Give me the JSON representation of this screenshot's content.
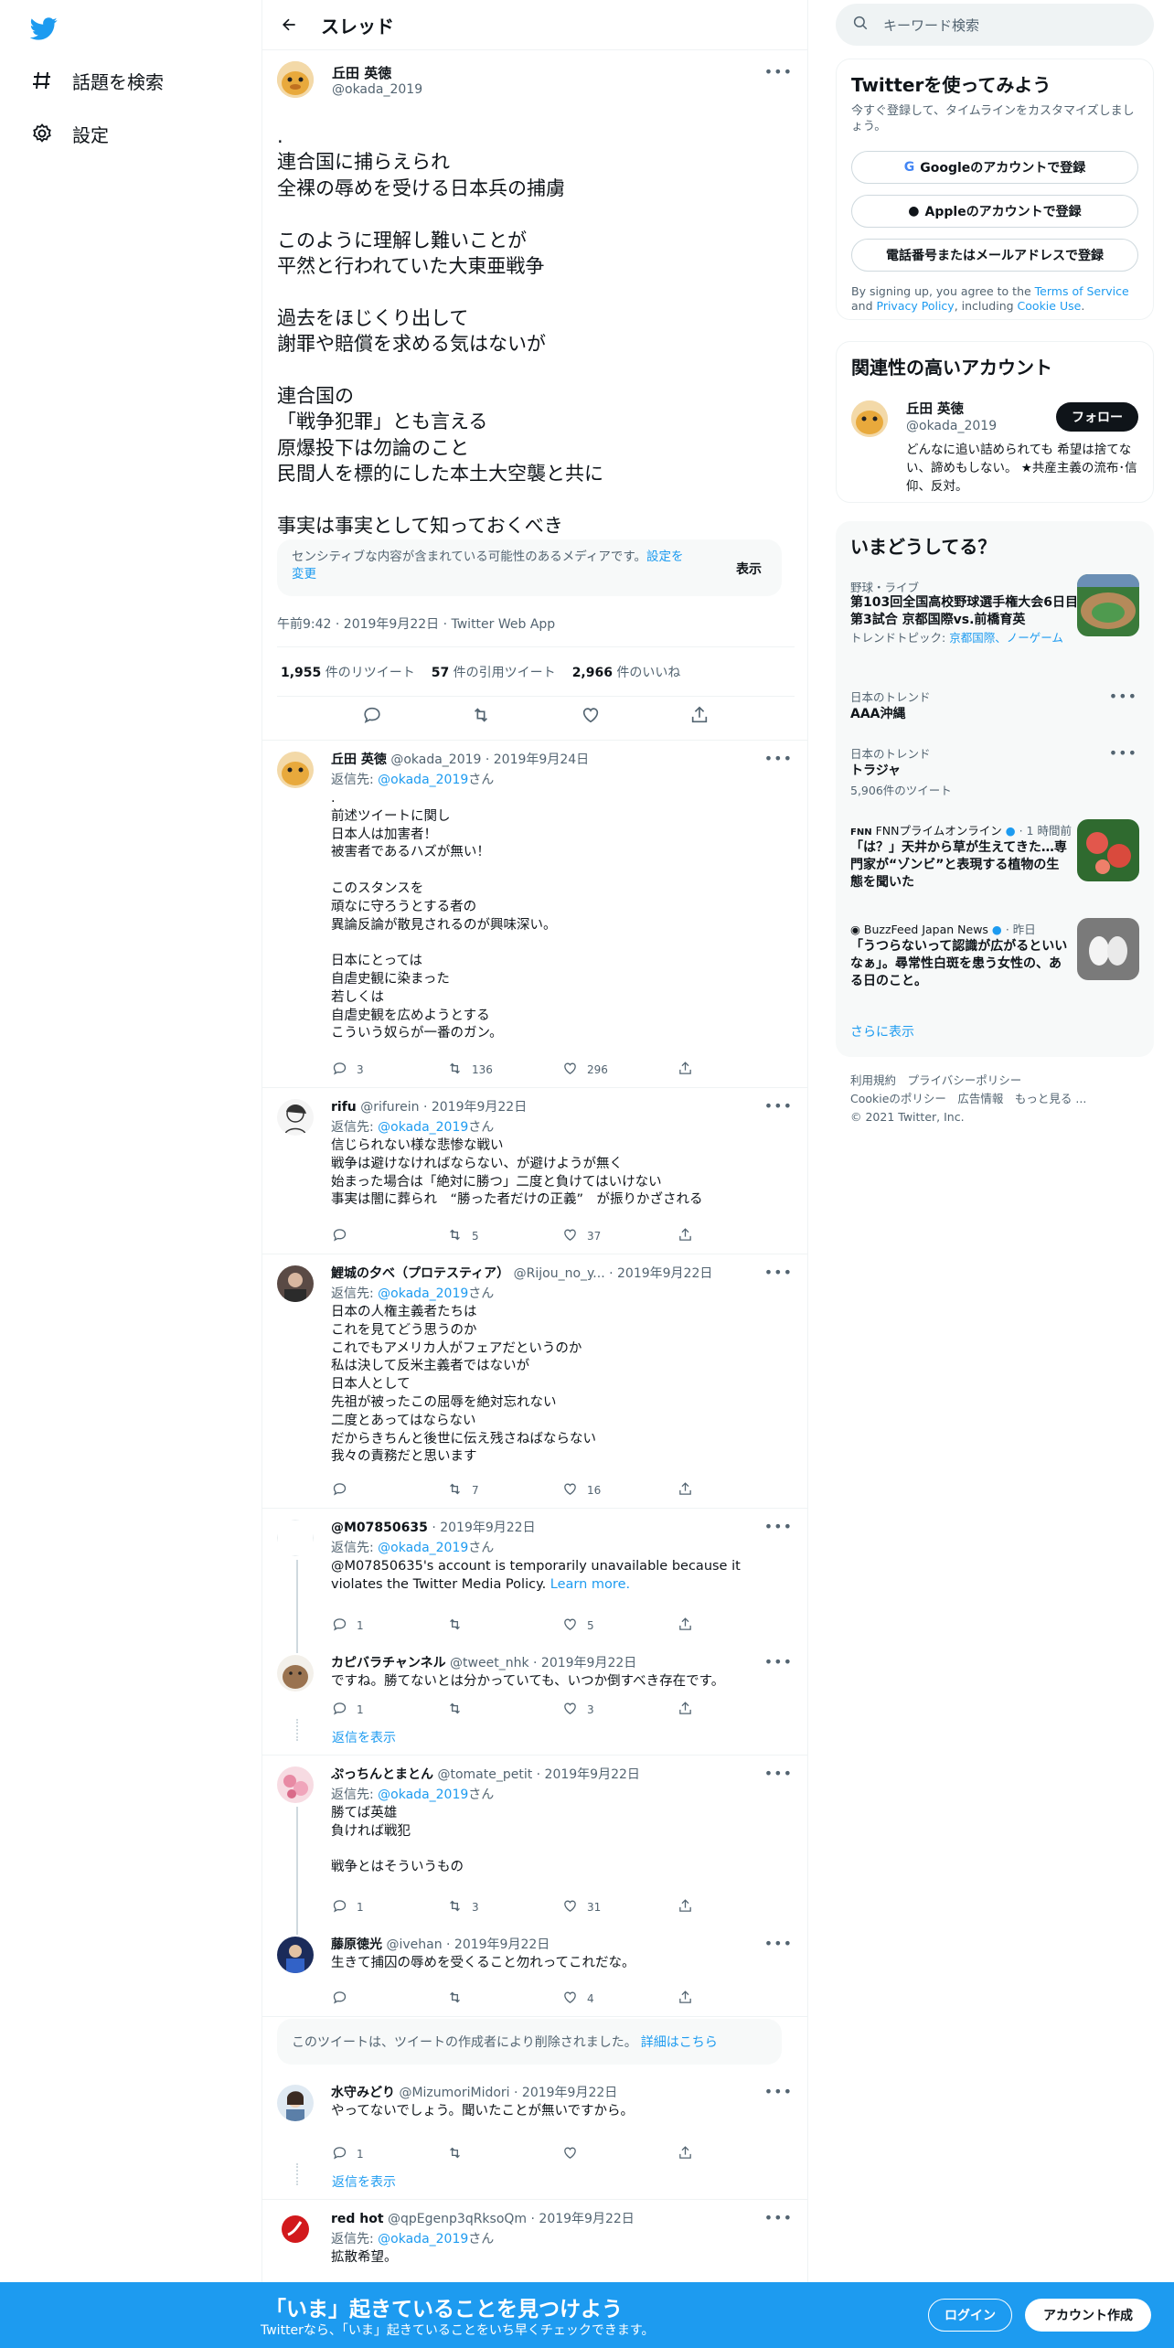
{
  "nav": {
    "explore": "話題を検索",
    "settings": "設定"
  },
  "header": {
    "title": "スレッド"
  },
  "main_tweet": {
    "name": "丘田 英徳",
    "handle": "@okada_2019",
    "text": ".\n連合国に捕らえられ\n全裸の辱めを受ける日本兵の捕虜\n\nこのように理解し難いことが\n平然と行われていた大東亜戦争\n\n過去をほじくり出して\n謝罪や賠償を求める気はないが\n\n連合国の\n「戦争犯罪」とも言える\n原爆投下は勿論のこと\n民間人を標的にした本土大空襲と共に\n\n事実は事実として知っておくべき",
    "sensitive_text": "センシティブな内容が含まれている可能性のあるメディアです。",
    "sensitive_link": "設定を変更",
    "sensitive_show": "表示",
    "meta": "午前9:42 · 2019年9月22日 · Twitter Web App",
    "retweets_num": "1,955",
    "retweets_label": " 件のリツイート",
    "quotes_num": "57",
    "quotes_label": " 件の引用ツイート",
    "likes_num": "2,966",
    "likes_label": " 件のいいね"
  },
  "replies": [
    {
      "name": "丘田 英徳",
      "handle": "@okada_2019 · 2019年9月24日",
      "reply_prefix": "返信先: ",
      "reply_to": "@okada_2019",
      "reply_suffix": "さん",
      "text": ".\n前述ツイートに関し\n日本人は加害者！\n被害者であるハズが無い！\n\nこのスタンスを\n頑なに守ろうとする者の\n異論反論が散見されるのが興味深い。\n\n日本にとっては\n自虐史観に染まった\n若しくは\n自虐史観を広めようとする\nこういう奴らが一番のガン。",
      "replies": "3",
      "retweets": "136",
      "likes": "296"
    },
    {
      "name": "rifu",
      "handle": "@rifurein · 2019年9月22日",
      "reply_prefix": "返信先: ",
      "reply_to": "@okada_2019",
      "reply_suffix": "さん",
      "text": "信じられない様な悲惨な戦い\n戦争は避けなければならない、が避けようが無く\n始まった場合は「絶対に勝つ」二度と負けてはいけない\n事実は闇に葬られ　“勝った者だけの正義”　が振りかざされる",
      "replies": "",
      "retweets": "5",
      "likes": "37"
    },
    {
      "name": "鯉城の夕べ（プロテスティア）",
      "handle": "@Rijou_no_y... · 2019年9月22日",
      "reply_prefix": "返信先: ",
      "reply_to": "@okada_2019",
      "reply_suffix": "さん",
      "text": "日本の人権主義者たちは\nこれを見てどう思うのか\nこれでもアメリカ人がフェアだというのか\n私は決して反米主義者ではないが\n日本人として\n先祖が被ったこの屈辱を絶対忘れない\n二度とあってはならない\nだからきちんと後世に伝え残さねばならない\n我々の責務だと思います",
      "replies": "",
      "retweets": "7",
      "likes": "16"
    },
    {
      "name": "@M07850635",
      "handle": "· 2019年9月22日",
      "reply_prefix": "返信先: ",
      "reply_to": "@okada_2019",
      "reply_suffix": "さん",
      "text": "@M07850635's account is temporarily unavailable because it violates the Twitter Media Policy. ",
      "link": "Learn more.",
      "replies": "1",
      "retweets": "",
      "likes": "5"
    },
    {
      "name": "カピバラチャンネル",
      "handle": "@tweet_nhk · 2019年9月22日",
      "text": "ですね。勝てないとは分かっていても、いつか倒すべき存在です。",
      "replies": "1",
      "retweets": "",
      "likes": "3"
    },
    {
      "name": "ぷっちんとまとん",
      "handle": "@tomate_petit · 2019年9月22日",
      "reply_prefix": "返信先: ",
      "reply_to": "@okada_2019",
      "reply_suffix": "さん",
      "text": "勝てば英雄\n負ければ戦犯\n\n戦争とはそういうもの",
      "replies": "1",
      "retweets": "3",
      "likes": "31"
    },
    {
      "name": "藤原徳光",
      "handle": "@ivehan · 2019年9月22日",
      "text": "生きて捕囚の辱めを受くること勿れってこれだな。",
      "replies": "",
      "retweets": "",
      "likes": "4"
    },
    {
      "name": "水守みどり",
      "handle": "@MizumoriMidori · 2019年9月22日",
      "text": "やってないでしょう。聞いたことが無いですから。",
      "replies": "1",
      "retweets": "",
      "likes": ""
    },
    {
      "name": "red hot",
      "handle": "@qpEgenp3qRksoQm · 2019年9月22日",
      "reply_prefix": "返信先: ",
      "reply_to": "@okada_2019",
      "reply_suffix": "さん",
      "text": "拡散希望。"
    }
  ],
  "show_replies": "返信を表示",
  "deleted_notice": "このツイートは、ツイートの作成者により削除されました。",
  "deleted_link": "詳細はこちら",
  "sidebar": {
    "search_placeholder": "キーワード検索",
    "signup_title": "Twitterを使ってみよう",
    "signup_sub": "今すぐ登録して、タイムラインをカスタマイズしましょう。",
    "google": "Googleのアカウントで登録",
    "apple": "Appleのアカウントで登録",
    "phone": "電話番号またはメールアドレスで登録",
    "terms_a": "By signing up, you agree to the ",
    "terms_tos": "Terms of Service",
    "terms_and": " and ",
    "terms_pp": "Privacy Policy",
    "terms_incl": ", including ",
    "terms_cookie": "Cookie Use",
    "terms_end": ".",
    "related_title": "関連性の高いアカウント",
    "related_name": "丘田 英徳",
    "related_handle": "@okada_2019",
    "follow": "フォロー",
    "related_bio": "どんなに追い詰められても 希望は捨てない、諦めもしない。 ★共産主義の流布･信仰、反対。",
    "trends_title": "いまどうしてる？",
    "t1_cat": "野球・ライブ",
    "t1_title": "第103回全国高校野球選手権大会6日目 第3試合 京都国際vs.前橋育英",
    "t1_topic_label": "トレンドトピック: ",
    "t1_topic": "京都国際、ノーゲーム",
    "t2_cat": "日本のトレンド",
    "t2_title": "AAA沖縄",
    "t3_cat": "日本のトレンド",
    "t3_title": "トラジャ",
    "t3_count": "5,906件のツイート",
    "t4_src": "FNNプライムオンライン",
    "t4_time": "· 1 時間前",
    "t4_title": "「は？」天井から草が生えてきた…専門家が“ゾンビ”と表現する植物の生態を聞いた",
    "t5_src": "BuzzFeed Japan News",
    "t5_time": "· 昨日",
    "t5_title": "「うつらないって認識が広がるといいなぁ」。尋常性白斑を患う女性の、ある日のこと。",
    "show_more": "さらに表示",
    "footer1": "利用規約　プライバシーポリシー",
    "footer2": "Cookieのポリシー　広告情報　もっと見る ...",
    "footer3": "© 2021 Twitter, Inc."
  },
  "bottom": {
    "title": "「いま」起きていることを見つけよう",
    "sub": "Twitterなら、「いま」起きていることをいち早くチェックできます。",
    "login": "ログイン",
    "signup": "アカウント作成"
  },
  "colors": {
    "accent": "#1d9bf0",
    "text": "#0f1419",
    "muted": "#536471"
  }
}
